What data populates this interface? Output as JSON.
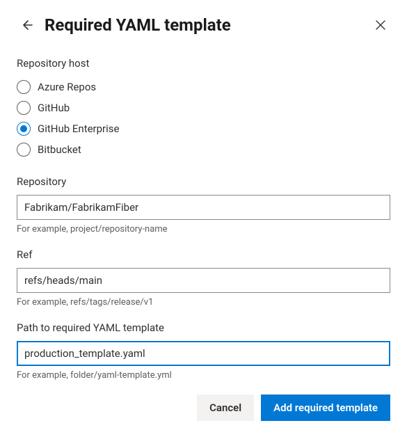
{
  "header": {
    "title": "Required YAML template"
  },
  "host": {
    "label": "Repository host",
    "options": [
      {
        "label": "Azure Repos",
        "selected": false
      },
      {
        "label": "GitHub",
        "selected": false
      },
      {
        "label": "GitHub Enterprise",
        "selected": true
      },
      {
        "label": "Bitbucket",
        "selected": false
      }
    ]
  },
  "repository": {
    "label": "Repository",
    "value": "Fabrikam/FabrikamFiber",
    "hint": "For example, project/repository-name"
  },
  "ref": {
    "label": "Ref",
    "value": "refs/heads/main",
    "hint": "For example, refs/tags/release/v1"
  },
  "path": {
    "label": "Path to required YAML template",
    "value": "production_template.yaml",
    "hint": "For example, folder/yaml-template.yml"
  },
  "buttons": {
    "cancel": "Cancel",
    "submit": "Add required template"
  }
}
